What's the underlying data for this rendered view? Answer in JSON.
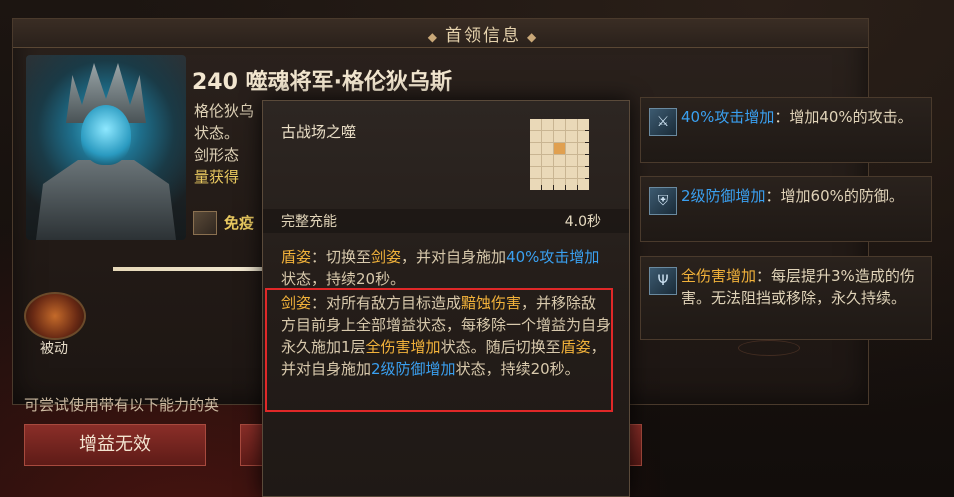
{
  "panel": {
    "title": "首领信息",
    "boss_name": "240 噬魂将军·格伦狄乌斯",
    "desc_lines": [
      "格伦狄乌",
      "状态。",
      "剑形态",
      "量获得"
    ],
    "immune_label": "免疫",
    "passive_label": "被动",
    "try_text": "可尝试使用带有以下能力的英",
    "bottom_buttons": [
      "增益无效",
      ""
    ]
  },
  "popup": {
    "title": "古战场之噬",
    "charge_label": "完整充能",
    "charge_value": "4.0秒",
    "shield": {
      "head": "盾姿",
      "t1": "：切换至",
      "k1": "剑姿",
      "t2": "，并对自身施加",
      "k2": "40%攻击增加",
      "t3": "状态，持续20秒。"
    },
    "sword": {
      "head": "剑姿",
      "t1": "：对所有敌方目标造成",
      "k1": "黯蚀伤害",
      "t2": "，并移除敌方目前身上全部增益状态，每移除一个增益为自身永久施加1层",
      "k2": "全伤害增加",
      "t3": "状态。随后切换至",
      "k3": "盾姿",
      "t4": "，并对自身施加",
      "k4": "2级防御增加",
      "t5": "状态，持续20秒。"
    }
  },
  "buffs": [
    {
      "icon": "sword-icon",
      "name": "40%攻击增加",
      "desc": "：增加40%的攻击。"
    },
    {
      "icon": "shield-icon",
      "name": "2级防御增加",
      "desc": "：增加60%的防御。"
    },
    {
      "icon": "trident-icon",
      "name": "全伤害增加",
      "desc": "：每层提升3%造成的伤害。无法阻挡或移除，永久持续。"
    }
  ],
  "colors": {
    "orange": "#f2b23a",
    "blue": "#3aa0f0",
    "highlight_box": "#e02828"
  }
}
